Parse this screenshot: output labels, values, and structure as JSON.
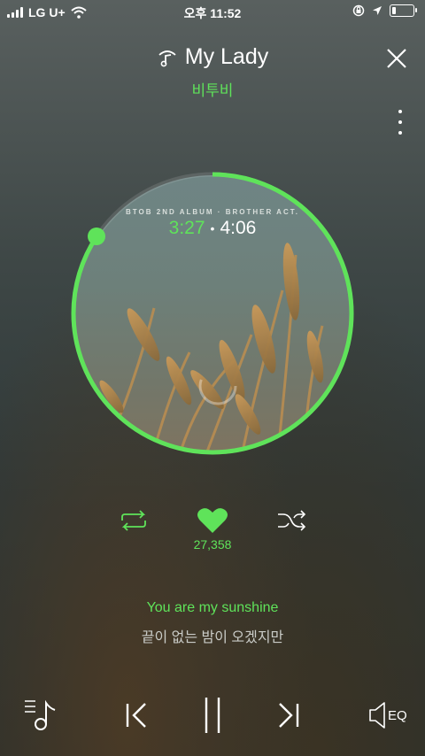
{
  "status_bar": {
    "carrier": "LG U+",
    "time": "오후 11:52",
    "battery_level": 0.2
  },
  "now_playing": {
    "title": "My Lady",
    "artist": "비투비",
    "album_line": "BTOB 2ND ALBUM · BROTHER ACT.",
    "current_time": "3:27",
    "separator": "•",
    "total_time": "4:06",
    "progress": 0.843
  },
  "actions": {
    "like_count": "27,358",
    "icons": [
      "repeat-icon",
      "heart-icon",
      "shuffle-icon"
    ]
  },
  "lyrics": {
    "current": "You are my sunshine",
    "next": "끝이 없는 밤이 오겠지만"
  },
  "bottom_bar": {
    "eq_label": "EQ",
    "icons": [
      "playlist-icon",
      "previous-icon",
      "pause-icon",
      "next-icon",
      "eq-icon"
    ]
  },
  "colors": {
    "accent": "#5fe35a",
    "text": "#ffffff"
  }
}
